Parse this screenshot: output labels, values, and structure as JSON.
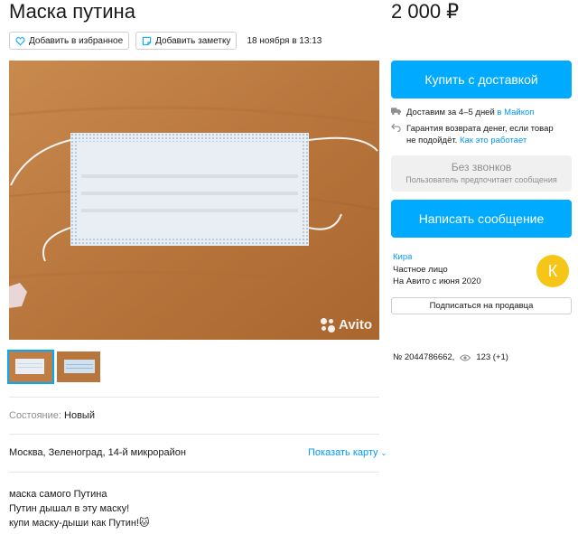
{
  "listing": {
    "title": "Маска путина",
    "price": "2 000 ₽",
    "date": "18 ноября в 13:13",
    "favorite_label": "Добавить в избранное",
    "note_label": "Добавить заметку",
    "watermark": "Avito",
    "condition_label": "Состояние:",
    "condition_value": "Новый",
    "location": "Москва, Зеленоград, 14-й микрорайон",
    "show_map_label": "Показать карту",
    "description": [
      "маска самого Путина",
      "Путин дышал в эту маску!",
      "купи маску-дыши как Путин!🐱"
    ],
    "id": "№ 2044786662,",
    "views": "123 (+1)"
  },
  "sidebar": {
    "buy_label": "Купить с доставкой",
    "delivery_text": "Доставим за 4–5 дней",
    "delivery_city": "в Майкоп",
    "guarantee_line1": "Гарантия возврата денег, если товар",
    "guarantee_line2": "не подойдёт.",
    "guarantee_link": "Как это работает",
    "nocall_title": "Без звонков",
    "nocall_sub": "Пользователь предпочитает сообщения",
    "message_label": "Написать сообщение",
    "subscribe_label": "Подписаться на продавца"
  },
  "seller": {
    "name": "Кира",
    "type": "Частное лицо",
    "since": "На Авито с июня 2020",
    "avatar_letter": "К"
  },
  "colors": {
    "accent": "#00aaff",
    "link": "#0099f7",
    "avatar": "#f5c518"
  }
}
